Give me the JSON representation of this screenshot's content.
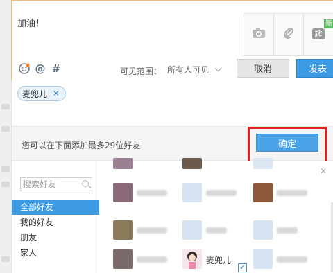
{
  "composer": {
    "text": "加油！",
    "badge_new": "新",
    "icons": [
      "camera-icon",
      "attachment-icon",
      "fun-icon"
    ]
  },
  "toolbar": {
    "emoji_icon": "emoji-icon",
    "mention_symbol": "@",
    "hashtag_symbol": "#",
    "scope_label": "可见范围：",
    "scope_value": "所有人可见",
    "cancel_label": "取消",
    "post_label": "发表"
  },
  "mention": {
    "selected_chip": "麦兜儿",
    "limit_text": "您可以在下面添加最多29位好友",
    "confirm_label": "确定"
  },
  "sidebar": {
    "search_placeholder": "搜索好友",
    "groups": [
      {
        "label": "全部好友"
      },
      {
        "label": "我的好友"
      },
      {
        "label": "朋友"
      },
      {
        "label": "家人"
      }
    ]
  },
  "friends": {
    "visible_name": "麦兜儿",
    "visible_checked": "✓"
  },
  "colors": {
    "accent": "#3b9ae1",
    "highlight": "#e52222"
  }
}
